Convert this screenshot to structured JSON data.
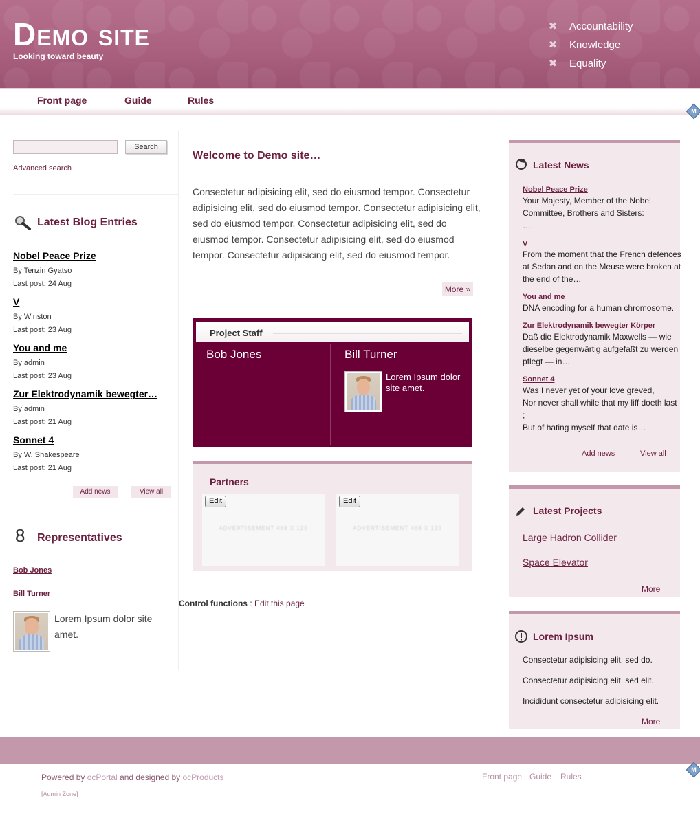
{
  "header": {
    "site_title": "Demo site",
    "tagline": "Looking toward beauty",
    "values": [
      "Accountability",
      "Knowledge",
      "Equality"
    ]
  },
  "nav": {
    "items": [
      "Front page",
      "Guide",
      "Rules"
    ]
  },
  "search": {
    "placeholder": "",
    "button": "Search",
    "advanced": "Advanced search"
  },
  "blog": {
    "title": "Latest Blog Entries",
    "entries": [
      {
        "title": "Nobel Peace Prize",
        "by": "By Tenzin Gyatso",
        "last": "Last post: 24 Aug"
      },
      {
        "title": "V",
        "by": "By Winston",
        "last": "Last post: 23 Aug"
      },
      {
        "title": "You and me",
        "by": "By admin",
        "last": "Last post: 23 Aug"
      },
      {
        "title": "Zur Elektrodynamik bewegter…",
        "by": "By admin",
        "last": "Last post: 21 Aug"
      },
      {
        "title": "Sonnet 4",
        "by": "By W. Shakespeare",
        "last": "Last post: 21 Aug"
      }
    ],
    "add_news": "Add news",
    "view_all": "View all"
  },
  "representatives": {
    "title": "Representatives",
    "links": [
      "Bob Jones",
      "Bill Turner"
    ],
    "text": "Lorem Ipsum dolor site amet."
  },
  "main": {
    "welcome": "Welcome to Demo site…",
    "intro": "Consectetur adipisicing elit, sed do eiusmod tempor. Consectetur adipisicing elit, sed do eiusmod tempor. Consectetur adipisicing elit, sed do eiusmod tempor. Consectetur adipisicing elit, sed do eiusmod tempor. Consectetur adipisicing elit, sed do eiusmod tempor. Consectetur adipisicing elit, sed do eiusmod tempor.",
    "more": "More »"
  },
  "staff": {
    "title": "Project Staff",
    "members": [
      {
        "name": "Bob Jones"
      },
      {
        "name": "Bill Turner",
        "desc": "Lorem Ipsum dolor site amet."
      }
    ]
  },
  "partners": {
    "title": "Partners",
    "edit": "Edit",
    "ad_text": "ADVERTISEMENT 468 X 120"
  },
  "control": {
    "label": "Control functions",
    "sep": " : ",
    "link": "Edit this page"
  },
  "news": {
    "title": "Latest News",
    "items": [
      {
        "title": "Nobel Peace Prize",
        "text": "Your Majesty, Member of the Nobel Committee, Brothers and Sisters:\n…"
      },
      {
        "title": "V",
        "text": "From the moment that the French defences at Sedan and on the Meuse were broken at the end of the…"
      },
      {
        "title": "You and me",
        "text": "DNA encoding for a human chromosome."
      },
      {
        "title": "Zur Elektrodynamik bewegter Körper",
        "text": "Daß die Elektrodynamik Maxwells — wie dieselbe gegenwärtig aufgefaßt zu werden pflegt — in…"
      },
      {
        "title": "Sonnet 4",
        "text": "Was I never yet of your love greved,\nNor never shall while that my liff doeth last\n;\nBut of hating myself that date is…"
      }
    ],
    "add_news": "Add news",
    "view_all": "View all"
  },
  "projects": {
    "title": "Latest Projects",
    "items": [
      "Large Hadron Collider",
      "Space Elevator"
    ],
    "more": "More"
  },
  "lorem": {
    "title": "Lorem Ipsum",
    "lines": [
      "Consectetur adipisicing elit, sed do.",
      "Consectetur adipisicing elit, sed elit.",
      "Incididunt consectetur adipisicing elit."
    ],
    "more": "More"
  },
  "footer": {
    "powered_prefix": "Powered by ",
    "ocportal": "ocPortal",
    "designed": " and designed by ",
    "ocproducts": "ocProducts",
    "admin_zone": "[Admin Zone]",
    "nav": [
      "Front page",
      "Guide",
      "Rules"
    ]
  },
  "colors": {
    "brand": "#a9607e",
    "dark": "#6b0036",
    "accent_text": "#6b1f3f",
    "panel_bg": "#f3e8ec"
  }
}
